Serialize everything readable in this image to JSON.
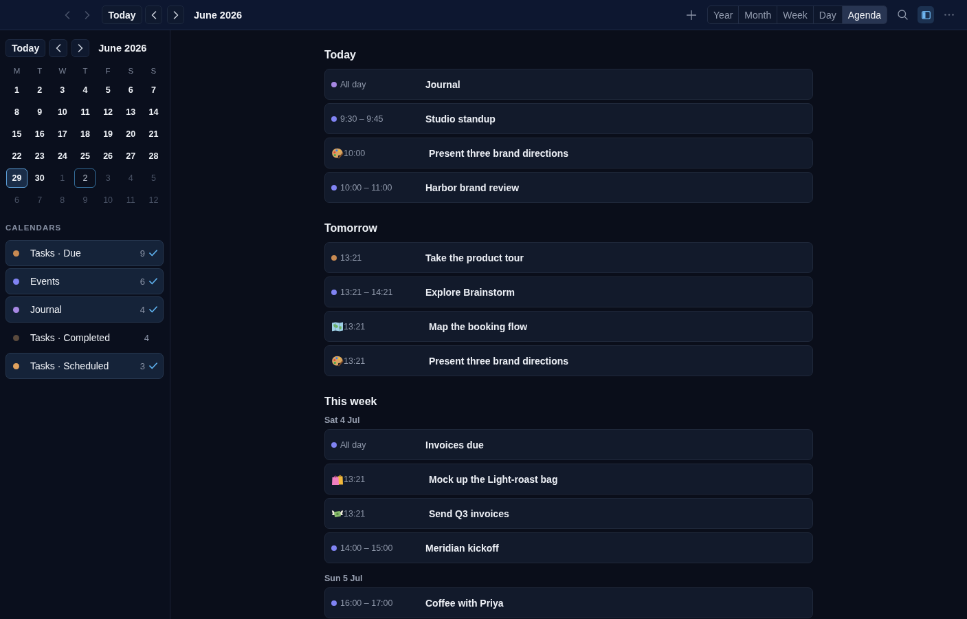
{
  "toolbar": {
    "today_button": "Today",
    "title": "June 2026",
    "views": [
      {
        "label": "Year",
        "selected": false
      },
      {
        "label": "Month",
        "selected": false
      },
      {
        "label": "Week",
        "selected": false
      },
      {
        "label": "Day",
        "selected": false
      },
      {
        "label": "Agenda",
        "selected": true
      }
    ],
    "sidebar_toggle": {
      "on": true
    }
  },
  "sidebar": {
    "mini_calendar": {
      "today_button": "Today",
      "title": "June 2026",
      "weekdays": [
        "M",
        "T",
        "W",
        "T",
        "F",
        "S",
        "S"
      ],
      "days": [
        {
          "label": "1",
          "in_month": true,
          "selected": false,
          "today": false
        },
        {
          "label": "2",
          "in_month": true,
          "selected": false,
          "today": false
        },
        {
          "label": "3",
          "in_month": true,
          "selected": false,
          "today": false
        },
        {
          "label": "4",
          "in_month": true,
          "selected": false,
          "today": false
        },
        {
          "label": "5",
          "in_month": true,
          "selected": false,
          "today": false
        },
        {
          "label": "6",
          "in_month": true,
          "selected": false,
          "today": false
        },
        {
          "label": "7",
          "in_month": true,
          "selected": false,
          "today": false
        },
        {
          "label": "8",
          "in_month": true,
          "selected": false,
          "today": false
        },
        {
          "label": "9",
          "in_month": true,
          "selected": false,
          "today": false
        },
        {
          "label": "10",
          "in_month": true,
          "selected": false,
          "today": false
        },
        {
          "label": "11",
          "in_month": true,
          "selected": false,
          "today": false
        },
        {
          "label": "12",
          "in_month": true,
          "selected": false,
          "today": false
        },
        {
          "label": "13",
          "in_month": true,
          "selected": false,
          "today": false
        },
        {
          "label": "14",
          "in_month": true,
          "selected": false,
          "today": false
        },
        {
          "label": "15",
          "in_month": true,
          "selected": false,
          "today": false
        },
        {
          "label": "16",
          "in_month": true,
          "selected": false,
          "today": false
        },
        {
          "label": "17",
          "in_month": true,
          "selected": false,
          "today": false
        },
        {
          "label": "18",
          "in_month": true,
          "selected": false,
          "today": false
        },
        {
          "label": "19",
          "in_month": true,
          "selected": false,
          "today": false
        },
        {
          "label": "20",
          "in_month": true,
          "selected": false,
          "today": false
        },
        {
          "label": "21",
          "in_month": true,
          "selected": false,
          "today": false
        },
        {
          "label": "22",
          "in_month": true,
          "selected": false,
          "today": false
        },
        {
          "label": "23",
          "in_month": true,
          "selected": false,
          "today": false
        },
        {
          "label": "24",
          "in_month": true,
          "selected": false,
          "today": false
        },
        {
          "label": "25",
          "in_month": true,
          "selected": false,
          "today": false
        },
        {
          "label": "26",
          "in_month": true,
          "selected": false,
          "today": false
        },
        {
          "label": "27",
          "in_month": true,
          "selected": false,
          "today": false
        },
        {
          "label": "28",
          "in_month": true,
          "selected": false,
          "today": false
        },
        {
          "label": "29",
          "in_month": true,
          "selected": true,
          "today": false
        },
        {
          "label": "30",
          "in_month": true,
          "selected": false,
          "today": false
        },
        {
          "label": "1",
          "in_month": false,
          "selected": false,
          "today": false
        },
        {
          "label": "2",
          "in_month": false,
          "selected": false,
          "today": true
        },
        {
          "label": "3",
          "in_month": false,
          "selected": false,
          "today": false
        },
        {
          "label": "4",
          "in_month": false,
          "selected": false,
          "today": false
        },
        {
          "label": "5",
          "in_month": false,
          "selected": false,
          "today": false
        },
        {
          "label": "6",
          "in_month": false,
          "selected": false,
          "today": false
        },
        {
          "label": "7",
          "in_month": false,
          "selected": false,
          "today": false
        },
        {
          "label": "8",
          "in_month": false,
          "selected": false,
          "today": false
        },
        {
          "label": "9",
          "in_month": false,
          "selected": false,
          "today": false
        },
        {
          "label": "10",
          "in_month": false,
          "selected": false,
          "today": false
        },
        {
          "label": "11",
          "in_month": false,
          "selected": false,
          "today": false
        },
        {
          "label": "12",
          "in_month": false,
          "selected": false,
          "today": false
        }
      ]
    },
    "calendars_heading": "CALENDARS",
    "calendars": [
      {
        "name": "Tasks · Due",
        "count": "9",
        "checked": true,
        "color": "#c88a52"
      },
      {
        "name": "Events",
        "count": "6",
        "checked": true,
        "color": "#8083f3"
      },
      {
        "name": "Journal",
        "count": "4",
        "checked": true,
        "color": "#a788e4"
      },
      {
        "name": "Tasks · Completed",
        "count": "4",
        "checked": false,
        "color": "#5a4a3d"
      },
      {
        "name": "Tasks · Scheduled",
        "count": "3",
        "checked": true,
        "color": "#e0a25e"
      }
    ]
  },
  "agenda": {
    "sections": [
      {
        "title": "Today",
        "events": [
          {
            "kind": "dot",
            "color": "#a788e4",
            "time": "All day",
            "title": "Journal"
          },
          {
            "kind": "dot",
            "color": "#8083f3",
            "time": "9:30 – 9:45",
            "title": "Studio standup"
          },
          {
            "kind": "palette",
            "time": "10:00",
            "title": "Present three brand directions"
          },
          {
            "kind": "dot",
            "color": "#8083f3",
            "time": "10:00 – 11:00",
            "title": "Harbor brand review"
          }
        ]
      },
      {
        "title": "Tomorrow",
        "events": [
          {
            "kind": "dot",
            "color": "#c88a52",
            "time": "13:21",
            "title": "Take the product tour"
          },
          {
            "kind": "dot",
            "color": "#8083f3",
            "time": "13:21 – 14:21",
            "title": "Explore Brainstorm"
          },
          {
            "kind": "map",
            "time": "13:21",
            "title": "Map the booking flow"
          },
          {
            "kind": "palette",
            "time": "13:21",
            "title": "Present three brand directions"
          }
        ]
      },
      {
        "title": "This week",
        "days": [
          {
            "label": "Sat 4 Jul",
            "events": [
              {
                "kind": "dot",
                "color": "#8083f3",
                "time": "All day",
                "title": "Invoices due"
              },
              {
                "kind": "bags",
                "time": "13:21",
                "title": "Mock up the Light-roast bag"
              },
              {
                "kind": "money",
                "time": "13:21",
                "title": "Send Q3 invoices"
              },
              {
                "kind": "dot",
                "color": "#8083f3",
                "time": "14:00 – 15:00",
                "title": "Meridian kickoff"
              }
            ]
          },
          {
            "label": "Sun 5 Jul",
            "events": [
              {
                "kind": "dot",
                "color": "#8083f3",
                "time": "16:00 – 17:00",
                "title": "Coffee with Priya"
              }
            ]
          }
        ]
      }
    ]
  }
}
